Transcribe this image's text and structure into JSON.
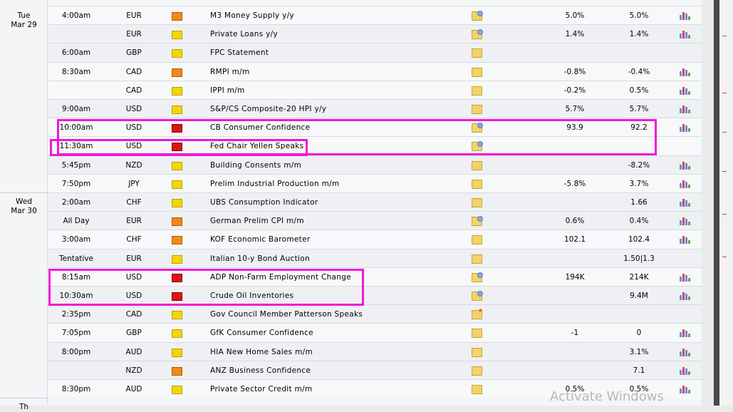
{
  "days": [
    {
      "line1": "Tue",
      "line2": "Mar 29"
    },
    {
      "line1": "Wed",
      "line2": "Mar 30"
    },
    {
      "line1": "Th",
      "line2": ""
    }
  ],
  "events": [
    {
      "time": "4:00am",
      "currency": "EUR",
      "impact": "med",
      "event": "M3 Money Supply y/y",
      "detail": "highlight",
      "actual": "5.0%",
      "forecast": "5.0%",
      "chart": true
    },
    {
      "time": "",
      "currency": "EUR",
      "impact": "low",
      "event": "Private Loans y/y",
      "detail": "highlight",
      "actual": "1.4%",
      "forecast": "1.4%",
      "chart": true
    },
    {
      "time": "6:00am",
      "currency": "GBP",
      "impact": "low",
      "event": "FPC Statement",
      "detail": "plain",
      "actual": "",
      "forecast": "",
      "chart": false
    },
    {
      "time": "8:30am",
      "currency": "CAD",
      "impact": "med",
      "event": "RMPI m/m",
      "detail": "plain",
      "actual": "-0.8%",
      "forecast": "-0.4%",
      "chart": true
    },
    {
      "time": "",
      "currency": "CAD",
      "impact": "low",
      "event": "IPPI m/m",
      "detail": "plain",
      "actual": "-0.2%",
      "forecast": "0.5%",
      "chart": true
    },
    {
      "time": "9:00am",
      "currency": "USD",
      "impact": "low",
      "event": "S&P/CS Composite-20 HPI y/y",
      "detail": "plain",
      "actual": "5.7%",
      "forecast": "5.7%",
      "chart": true
    },
    {
      "time": "10:00am",
      "currency": "USD",
      "impact": "high",
      "event": "CB Consumer Confidence",
      "detail": "highlight",
      "actual": "93.9",
      "forecast": "92.2",
      "chart": true
    },
    {
      "time": "11:30am",
      "currency": "USD",
      "impact": "high",
      "event": "Fed Chair Yellen Speaks",
      "detail": "highlight",
      "actual": "",
      "forecast": "",
      "chart": false
    },
    {
      "time": "5:45pm",
      "currency": "NZD",
      "impact": "low",
      "event": "Building Consents m/m",
      "detail": "plain",
      "actual": "",
      "forecast": "-8.2%",
      "chart": true
    },
    {
      "time": "7:50pm",
      "currency": "JPY",
      "impact": "low",
      "event": "Prelim Industrial Production m/m",
      "detail": "plain",
      "actual": "-5.8%",
      "forecast": "3.7%",
      "chart": true
    },
    {
      "time": "2:00am",
      "currency": "CHF",
      "impact": "low",
      "event": "UBS Consumption Indicator",
      "detail": "plain",
      "actual": "",
      "forecast": "1.66",
      "chart": true
    },
    {
      "time": "All Day",
      "currency": "EUR",
      "impact": "med",
      "event": "German Prelim CPI m/m",
      "detail": "highlight",
      "actual": "0.6%",
      "forecast": "0.4%",
      "chart": true
    },
    {
      "time": "3:00am",
      "currency": "CHF",
      "impact": "med",
      "event": "KOF Economic Barometer",
      "detail": "plain",
      "actual": "102.1",
      "forecast": "102.4",
      "chart": true
    },
    {
      "time": "Tentative",
      "currency": "EUR",
      "impact": "low",
      "event": "Italian 10-y Bond Auction",
      "detail": "plain",
      "actual": "",
      "forecast": "1.50|1.3",
      "chart": false
    },
    {
      "time": "8:15am",
      "currency": "USD",
      "impact": "high",
      "event": "ADP Non-Farm Employment Change",
      "detail": "highlight",
      "actual": "194K",
      "forecast": "214K",
      "chart": true
    },
    {
      "time": "10:30am",
      "currency": "USD",
      "impact": "high",
      "event": "Crude Oil Inventories",
      "detail": "highlight",
      "actual": "",
      "forecast": "9.4M",
      "chart": true
    },
    {
      "time": "2:35pm",
      "currency": "CAD",
      "impact": "low",
      "event": "Gov Council Member Patterson Speaks",
      "detail": "star",
      "actual": "",
      "forecast": "",
      "chart": false
    },
    {
      "time": "7:05pm",
      "currency": "GBP",
      "impact": "low",
      "event": "GfK Consumer Confidence",
      "detail": "plain",
      "actual": "-1",
      "forecast": "0",
      "chart": true
    },
    {
      "time": "8:00pm",
      "currency": "AUD",
      "impact": "low",
      "event": "HIA New Home Sales m/m",
      "detail": "plain",
      "actual": "",
      "forecast": "3.1%",
      "chart": true
    },
    {
      "time": "",
      "currency": "NZD",
      "impact": "med",
      "event": "ANZ Business Confidence",
      "detail": "plain",
      "actual": "",
      "forecast": "7.1",
      "chart": true
    },
    {
      "time": "8:30pm",
      "currency": "AUD",
      "impact": "low",
      "event": "Private Sector Credit m/m",
      "detail": "plain",
      "actual": "0.5%",
      "forecast": "0.5%",
      "chart": true
    }
  ],
  "watermark": "Activate Windows",
  "colors": {
    "highlight_box": "#f216d9",
    "impact_high": "#d91616",
    "impact_med": "#ef8a1a",
    "impact_low": "#f3d600"
  }
}
